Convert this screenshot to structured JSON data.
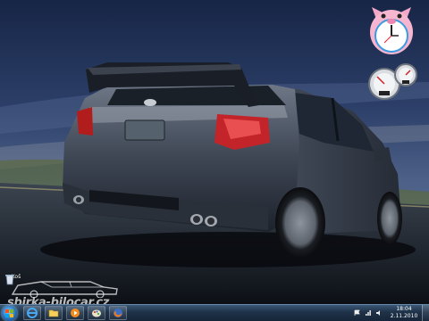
{
  "desktop": {
    "wallpaper_subject": "Dark grey Subaru sedan with large rear spoiler driving on a road",
    "plate_text": "",
    "colors": {
      "sky_top": "#1b2c50",
      "sky_mid": "#3a4f7a",
      "road": "#1b2129",
      "car_body": "#3e4654"
    }
  },
  "recycle_bin": {
    "label": "Koš"
  },
  "watermark": {
    "text": "sbirka-bilocar.cz"
  },
  "gadgets": {
    "clock": {
      "icon": "pig-clock-gadget"
    },
    "cpu_meter": {
      "icon": "cpu-meter-gadget"
    }
  },
  "taskbar": {
    "pinned": [
      {
        "name": "start-orb",
        "icon": "windows-flag-icon"
      },
      {
        "name": "internet-explorer",
        "icon": "ie-icon"
      },
      {
        "name": "explorer",
        "icon": "folder-icon"
      },
      {
        "name": "media-player",
        "icon": "media-player-icon"
      },
      {
        "name": "paint",
        "icon": "paint-icon"
      },
      {
        "name": "firefox",
        "icon": "firefox-icon"
      }
    ],
    "tray_icons": [
      "network-icon",
      "volume-icon",
      "flag-icon"
    ],
    "clock": {
      "time": "18:04",
      "date": "2.11.2010"
    }
  }
}
